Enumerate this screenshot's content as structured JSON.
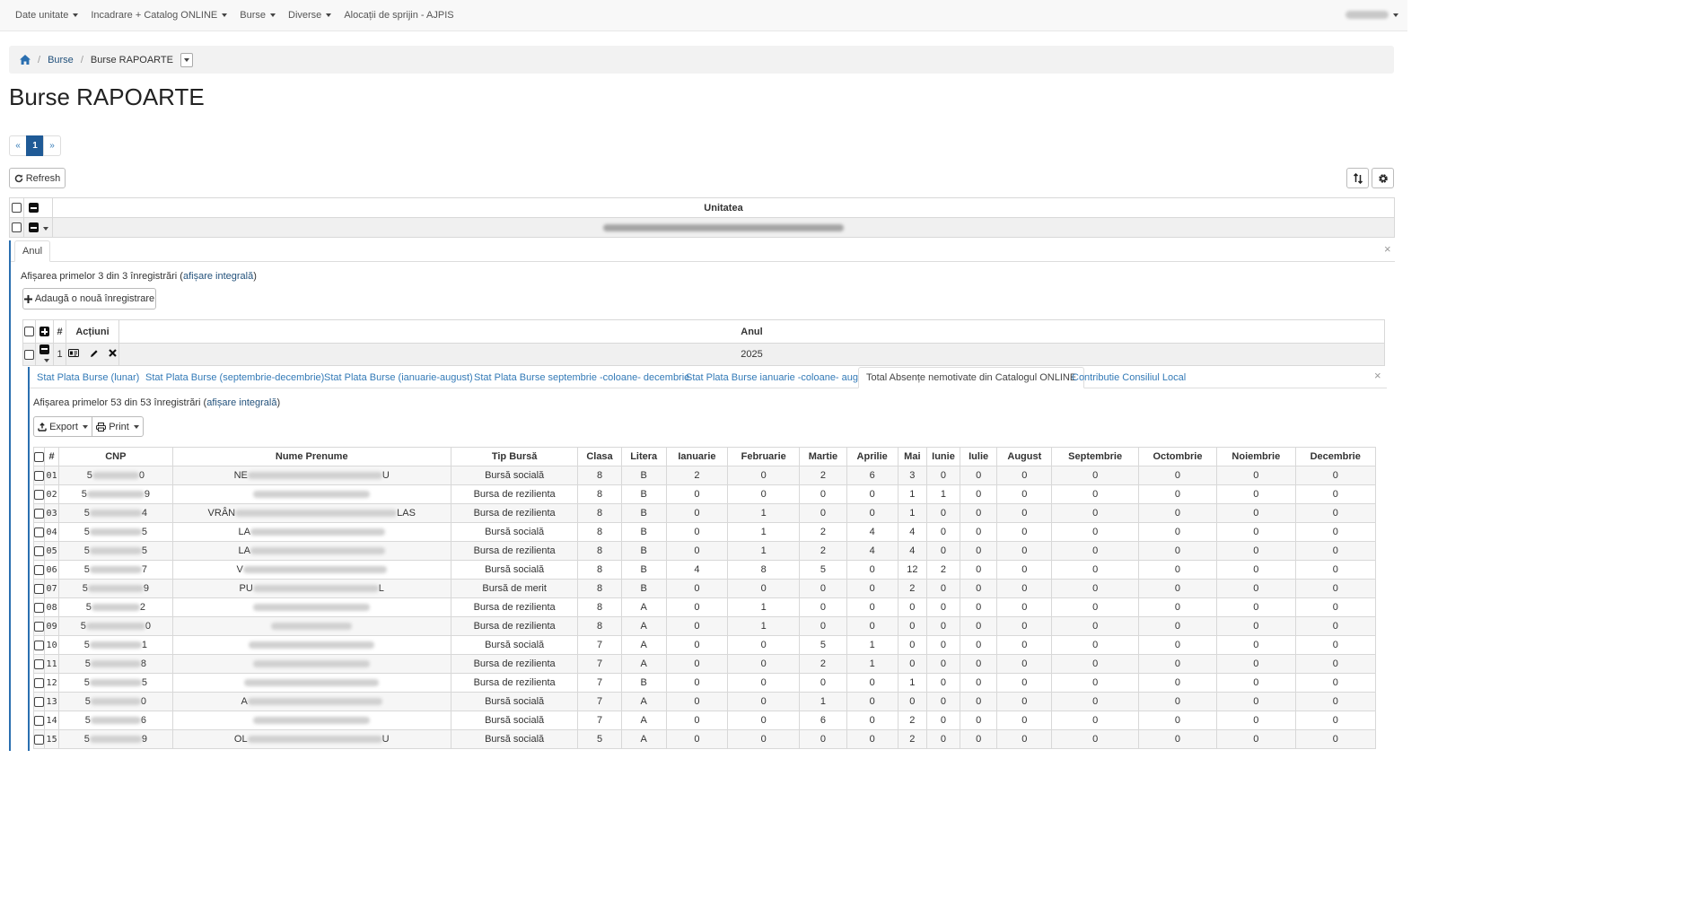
{
  "navbar": {
    "items": [
      {
        "label": "Date unitate",
        "dropdown": true
      },
      {
        "label": "Incadrare + Catalog ONLINE",
        "dropdown": true
      },
      {
        "label": "Burse",
        "dropdown": true
      },
      {
        "label": "Diverse",
        "dropdown": true
      },
      {
        "label": "Alocații de sprijin - AJPIS",
        "dropdown": false
      }
    ]
  },
  "breadcrumb": {
    "home_icon": "home-icon",
    "link": "Burse",
    "active": "Burse RAPOARTE"
  },
  "page_title": "Burse RAPOARTE",
  "pagination": {
    "prev": "«",
    "current": "1",
    "next": "»"
  },
  "toolbar": {
    "refresh_label": "Refresh",
    "sort_icon": "sort-icon",
    "settings_icon": "gear-icon"
  },
  "outer_table": {
    "header": "Unitatea"
  },
  "panel": {
    "tab": "Anul",
    "info_prefix": "Afișarea primelor 3 din 3 înregistrări (",
    "info_link": "afișare integrală",
    "info_suffix": ")",
    "add_label": "Adaugă o nouă înregistrare",
    "table": {
      "headers": {
        "num": "#",
        "actions": "Acțiuni",
        "year": "Anul"
      },
      "row": {
        "num": "1",
        "year": "2025"
      }
    }
  },
  "inner_panel": {
    "tabs": [
      "Stat Plata Burse (lunar)",
      "Stat Plata Burse (septembrie-decembrie)",
      "Stat Plata Burse (ianuarie-august)",
      "Stat Plata Burse septembrie -coloane- decembrie",
      "Stat Plata Burse ianuarie -coloane- august",
      "Total Absențe nemotivate din Catalogul ONLINE",
      "Contributie Consiliul Local"
    ],
    "active_tab": 5,
    "info_prefix": "Afișarea primelor 53 din 53 înregistrări (",
    "info_link": "afișare integrală",
    "info_suffix": ")",
    "export_label": "Export",
    "print_label": "Print"
  },
  "data_table": {
    "columns": [
      "#",
      "CNP",
      "Nume Prenume",
      "Tip Bursă",
      "Clasa",
      "Litera",
      "Ianuarie",
      "Februarie",
      "Martie",
      "Aprilie",
      "Mai",
      "Iunie",
      "Iulie",
      "August",
      "Septembrie",
      "Octombrie",
      "Noiembrie",
      "Decembrie"
    ],
    "rows": [
      {
        "idx": "01",
        "cnp_start": "5",
        "cnp_end": "0",
        "name_start": "NE",
        "name_end": "U",
        "tip": "Bursă socială",
        "clasa": "8",
        "litera": "B",
        "months": [
          "2",
          "0",
          "2",
          "6",
          "3",
          "0",
          "0",
          "0",
          "0",
          "0",
          "0",
          "0"
        ]
      },
      {
        "idx": "02",
        "cnp_start": "5",
        "cnp_end": "9",
        "name_start": "",
        "name_end": "",
        "tip": "Bursa de rezilienta",
        "clasa": "8",
        "litera": "B",
        "months": [
          "0",
          "0",
          "0",
          "0",
          "1",
          "1",
          "0",
          "0",
          "0",
          "0",
          "0",
          "0"
        ]
      },
      {
        "idx": "03",
        "cnp_start": "5",
        "cnp_end": "4",
        "name_start": "VRÂN",
        "name_end": "LAS",
        "tip": "Bursa de rezilienta",
        "clasa": "8",
        "litera": "B",
        "months": [
          "0",
          "1",
          "0",
          "0",
          "1",
          "0",
          "0",
          "0",
          "0",
          "0",
          "0",
          "0"
        ]
      },
      {
        "idx": "04",
        "cnp_start": "5",
        "cnp_end": "5",
        "name_start": "LA",
        "name_end": "",
        "tip": "Bursă socială",
        "clasa": "8",
        "litera": "B",
        "months": [
          "0",
          "1",
          "2",
          "4",
          "4",
          "0",
          "0",
          "0",
          "0",
          "0",
          "0",
          "0"
        ]
      },
      {
        "idx": "05",
        "cnp_start": "5",
        "cnp_end": "5",
        "name_start": "LA",
        "name_end": "",
        "tip": "Bursa de rezilienta",
        "clasa": "8",
        "litera": "B",
        "months": [
          "0",
          "1",
          "2",
          "4",
          "4",
          "0",
          "0",
          "0",
          "0",
          "0",
          "0",
          "0"
        ]
      },
      {
        "idx": "06",
        "cnp_start": "5",
        "cnp_end": "7",
        "name_start": "V",
        "name_end": "",
        "tip": "Bursă socială",
        "clasa": "8",
        "litera": "B",
        "months": [
          "4",
          "8",
          "5",
          "0",
          "12",
          "2",
          "0",
          "0",
          "0",
          "0",
          "0",
          "0"
        ]
      },
      {
        "idx": "07",
        "cnp_start": "5",
        "cnp_end": "9",
        "name_start": "PU",
        "name_end": "L",
        "tip": "Bursă de merit",
        "clasa": "8",
        "litera": "B",
        "months": [
          "0",
          "0",
          "0",
          "0",
          "2",
          "0",
          "0",
          "0",
          "0",
          "0",
          "0",
          "0"
        ]
      },
      {
        "idx": "08",
        "cnp_start": "5",
        "cnp_end": "2",
        "name_start": "",
        "name_end": "",
        "tip": "Bursa de rezilienta",
        "clasa": "8",
        "litera": "A",
        "months": [
          "0",
          "1",
          "0",
          "0",
          "0",
          "0",
          "0",
          "0",
          "0",
          "0",
          "0",
          "0"
        ]
      },
      {
        "idx": "09",
        "cnp_start": "5",
        "cnp_end": "0",
        "name_start": "",
        "name_end": "",
        "tip": "Bursa de rezilienta",
        "clasa": "8",
        "litera": "A",
        "months": [
          "0",
          "1",
          "0",
          "0",
          "0",
          "0",
          "0",
          "0",
          "0",
          "0",
          "0",
          "0"
        ]
      },
      {
        "idx": "10",
        "cnp_start": "5",
        "cnp_end": "1",
        "name_start": "",
        "name_end": "",
        "tip": "Bursă socială",
        "clasa": "7",
        "litera": "A",
        "months": [
          "0",
          "0",
          "5",
          "1",
          "0",
          "0",
          "0",
          "0",
          "0",
          "0",
          "0",
          "0"
        ]
      },
      {
        "idx": "11",
        "cnp_start": "5",
        "cnp_end": "8",
        "name_start": "",
        "name_end": "",
        "tip": "Bursa de rezilienta",
        "clasa": "7",
        "litera": "A",
        "months": [
          "0",
          "0",
          "2",
          "1",
          "0",
          "0",
          "0",
          "0",
          "0",
          "0",
          "0",
          "0"
        ]
      },
      {
        "idx": "12",
        "cnp_start": "5",
        "cnp_end": "5",
        "name_start": "",
        "name_end": "",
        "tip": "Bursa de rezilienta",
        "clasa": "7",
        "litera": "B",
        "months": [
          "0",
          "0",
          "0",
          "0",
          "1",
          "0",
          "0",
          "0",
          "0",
          "0",
          "0",
          "0"
        ]
      },
      {
        "idx": "13",
        "cnp_start": "5",
        "cnp_end": "0",
        "name_start": "A",
        "name_end": "",
        "tip": "Bursă socială",
        "clasa": "7",
        "litera": "A",
        "months": [
          "0",
          "0",
          "1",
          "0",
          "0",
          "0",
          "0",
          "0",
          "0",
          "0",
          "0",
          "0"
        ]
      },
      {
        "idx": "14",
        "cnp_start": "5",
        "cnp_end": "6",
        "name_start": "",
        "name_end": "",
        "tip": "Bursă socială",
        "clasa": "7",
        "litera": "A",
        "months": [
          "0",
          "0",
          "6",
          "0",
          "2",
          "0",
          "0",
          "0",
          "0",
          "0",
          "0",
          "0"
        ]
      },
      {
        "idx": "15",
        "cnp_start": "5",
        "cnp_end": "9",
        "name_start": "OL",
        "name_end": "U",
        "tip": "Bursă socială",
        "clasa": "5",
        "litera": "A",
        "months": [
          "0",
          "0",
          "0",
          "0",
          "2",
          "0",
          "0",
          "0",
          "0",
          "0",
          "0",
          "0"
        ]
      }
    ]
  }
}
